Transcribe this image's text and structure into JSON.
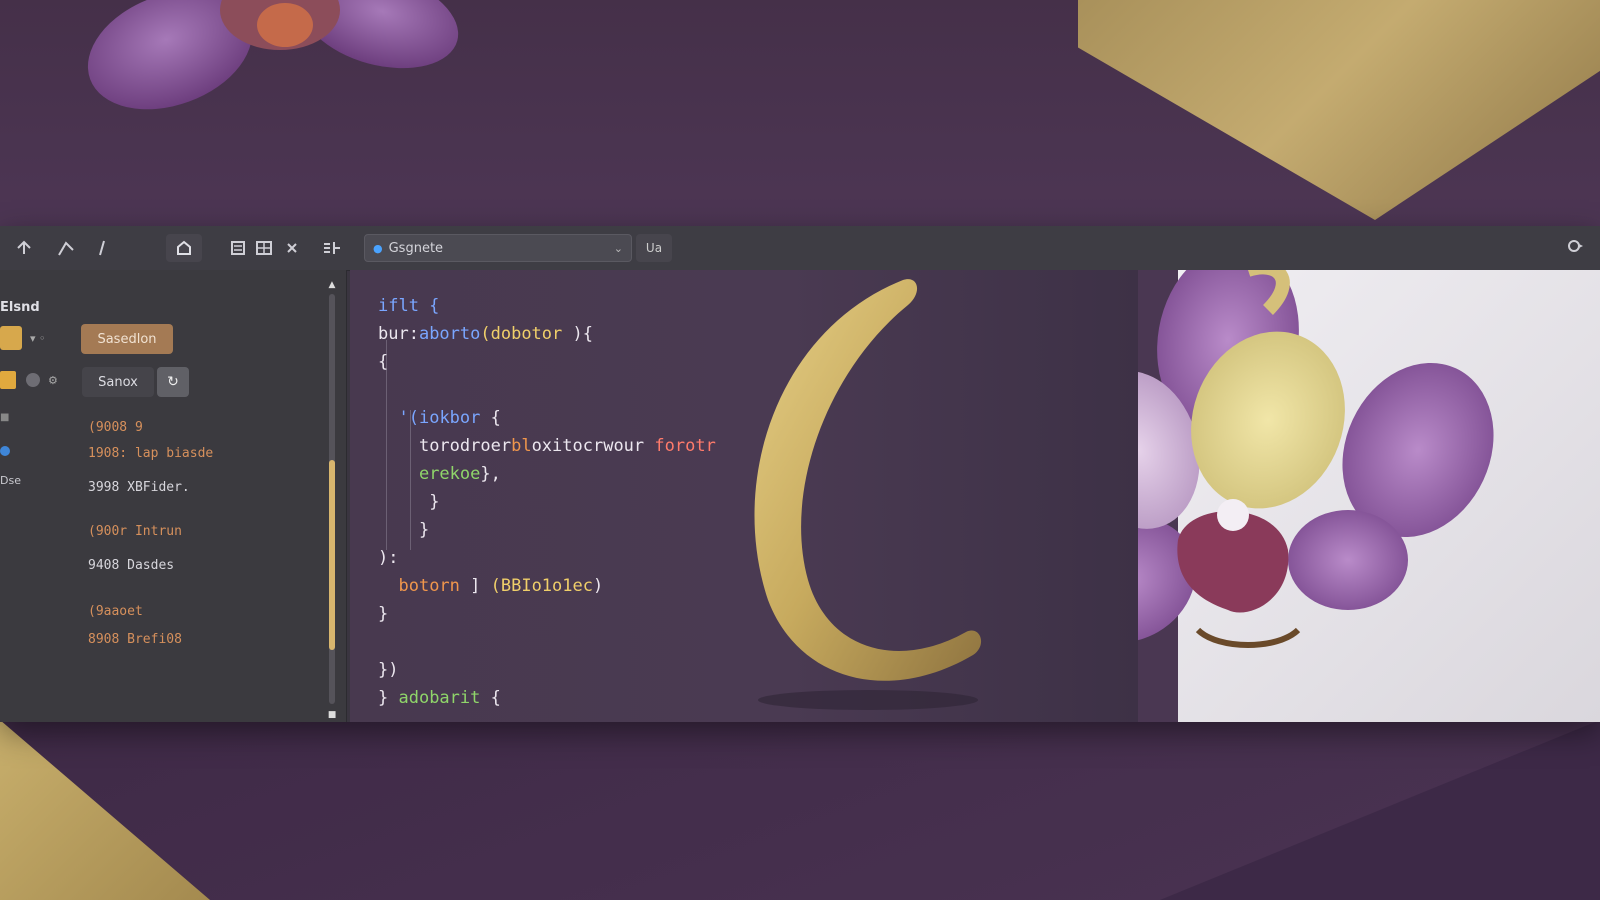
{
  "toolbar": {
    "search_text": "Gsgnete",
    "search_after_label": "Ua",
    "icons": [
      "undo-icon",
      "pen-icon",
      "line-icon",
      "shape-icon",
      "list-icon",
      "grid-icon",
      "close-icon",
      "split-icon",
      "search-icon",
      "chevron-down-icon",
      "share-icon"
    ]
  },
  "sidebar": {
    "heading": "Elsnd",
    "primary_button": "Sasedlon",
    "secondary_button": "Sanox",
    "small_label_1": "Dse",
    "items": [
      {
        "key": "(9008 9",
        "value": ""
      },
      {
        "key": "1908:",
        "value": "lap biasde"
      },
      {
        "key": "3998",
        "value": "XBFider."
      },
      {
        "key": "(900r",
        "value": "Intrun"
      },
      {
        "key": "9408",
        "value": "Dasdes"
      },
      {
        "key": "(9aaoet",
        "value": ""
      },
      {
        "key": "8908",
        "value": "Brefi08"
      }
    ]
  },
  "code": {
    "line1": "iflt {",
    "line2a": "bur:",
    "line2b": "aborto",
    "line2c": "(dobotor",
    "line2d": " ){",
    "line3": "{",
    "line4a": "'(",
    "line4b": "iokbor",
    "line4c": " {",
    "line5a": "torodroer",
    "line5b": "bl",
    "line5c": "oxitocrwour",
    "line5d": " forotr",
    "line6a": "erekoe",
    "line6b": "},",
    "line7": "}",
    "line8": "}",
    "line9": "):",
    "line10a": "botorn",
    "line10b": " ] ",
    "line10c": "(BBIo1o1ec",
    "line10d": ")",
    "line11": "}",
    "line12": "})",
    "line13a": "} ",
    "line13b": "adobarit",
    "line13c": " {"
  },
  "colors": {
    "gold": "#c9ad6a",
    "purple_bg": "#4a3450",
    "accent_orange": "#a47a54",
    "blue": "#3f86d8"
  }
}
